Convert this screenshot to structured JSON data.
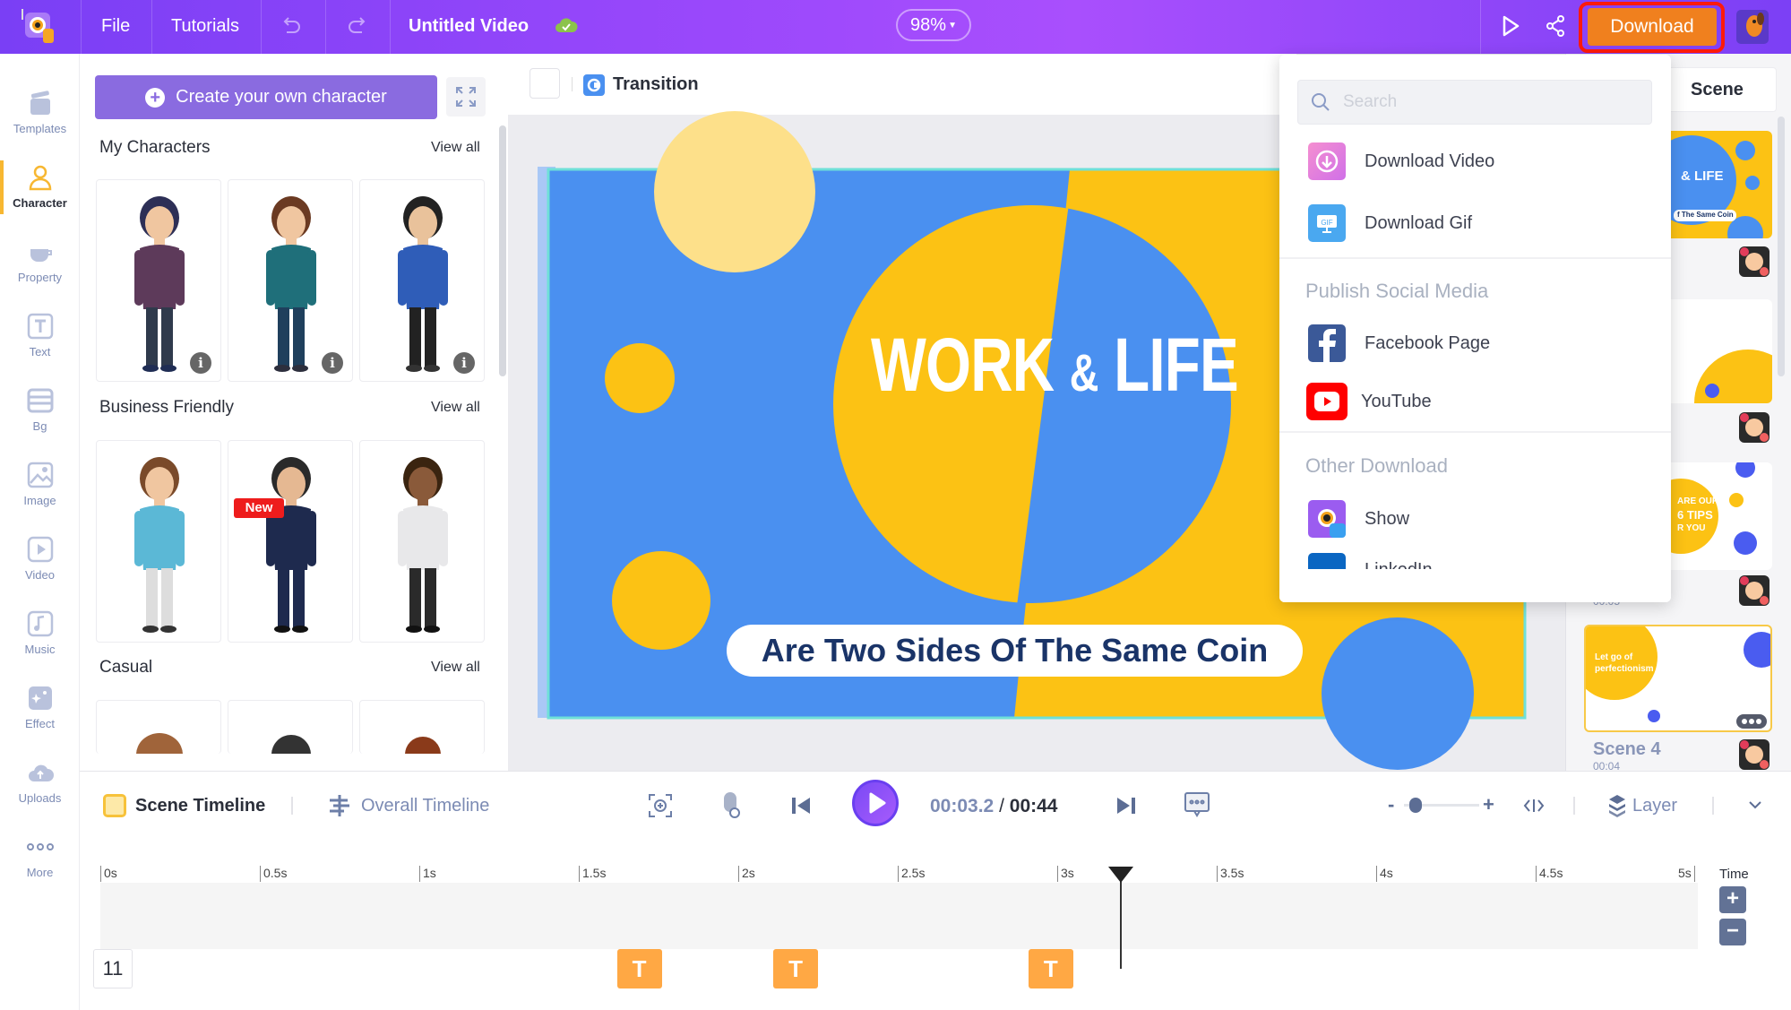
{
  "topbar": {
    "menu": [
      "File",
      "Tutorials"
    ],
    "project_title": "Untitled Video",
    "zoom": "98%",
    "download_label": "Download"
  },
  "leftnav": [
    {
      "label": "Templates",
      "icon": "templates-icon"
    },
    {
      "label": "Character",
      "icon": "character-icon",
      "active": true
    },
    {
      "label": "Property",
      "icon": "property-icon"
    },
    {
      "label": "Text",
      "icon": "text-icon"
    },
    {
      "label": "Bg",
      "icon": "bg-icon"
    },
    {
      "label": "Image",
      "icon": "image-icon"
    },
    {
      "label": "Video",
      "icon": "video-icon"
    },
    {
      "label": "Music",
      "icon": "music-icon"
    },
    {
      "label": "Effect",
      "icon": "effect-icon"
    },
    {
      "label": "Uploads",
      "icon": "uploads-icon"
    },
    {
      "label": "More",
      "icon": "more-icon"
    }
  ],
  "character_panel": {
    "create_label": "Create your own character",
    "sections": [
      {
        "title": "My Characters",
        "view_all": "View all"
      },
      {
        "title": "Business Friendly",
        "view_all": "View all",
        "badge": "New"
      },
      {
        "title": "Casual",
        "view_all": "View all"
      }
    ]
  },
  "canvas": {
    "transition_label": "Transition",
    "slide_title_1": "WORK",
    "slide_title_amp": "&",
    "slide_title_2": "LIFE",
    "slide_subtitle": "Are Two Sides Of The Same Coin",
    "colors": {
      "blue": "#4a90f0",
      "yellow": "#fcc214"
    }
  },
  "scene_panel": {
    "add_label": "Scene",
    "thumb1_title": "& LIFE",
    "thumb1_sub": "f The Same Coin",
    "thumb3_lines": [
      "ARE OUR",
      "6 TIPS",
      "R YOU"
    ],
    "thumb3_time": "00:05",
    "thumb4_text": "Let go of perfectionism",
    "scene4_name": "Scene 4",
    "scene4_time": "00:04"
  },
  "download_menu": {
    "search_placeholder": "Search",
    "items": [
      "Download Video",
      "Download Gif"
    ],
    "social_heading": "Publish Social Media",
    "social": [
      "Facebook Page",
      "YouTube"
    ],
    "other_heading": "Other Download",
    "other": [
      "Show",
      "LinkedIn"
    ]
  },
  "timeline": {
    "scene_tab": "Scene Timeline",
    "overall_tab": "Overall Timeline",
    "current_time": "00:03.2",
    "separator": "/",
    "total_time": "00:44",
    "layer_label": "Layer",
    "ticks": [
      "0s",
      "0.5s",
      "1s",
      "1.5s",
      "2s",
      "2.5s",
      "3s",
      "3.5s",
      "4s",
      "4.5s",
      "5s"
    ],
    "time_label": "Time",
    "zoom_in": "+",
    "zoom_out": "−",
    "scene_number": "11",
    "text_block_label": "T",
    "playhead_seconds": 3.2,
    "zoom_slider_fraction": 0.1
  }
}
